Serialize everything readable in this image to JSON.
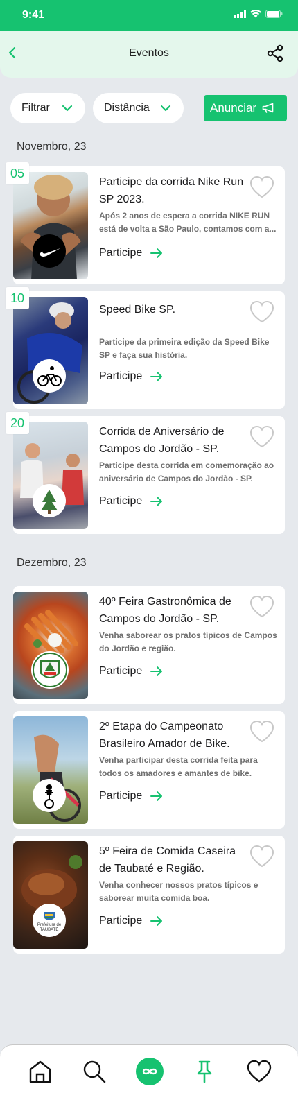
{
  "status": {
    "time": "9:41"
  },
  "header": {
    "title": "Eventos"
  },
  "filters": {
    "filtrar": "Filtrar",
    "distancia": "Distância",
    "anunciar": "Anunciar"
  },
  "sections": [
    {
      "month": "Novembro, 23",
      "events": [
        {
          "date": "05",
          "title": "Participe da corrida Nike Run SP 2023.",
          "description": "Após 2 anos de espera a corrida NIKE RUN está de volta a São Paulo, contamos com a...",
          "cta": "Participe"
        },
        {
          "date": "10",
          "title": "Speed Bike SP.",
          "description": "Participe da primeira edição da Speed Bike SP e faça sua história.",
          "cta": "Participe"
        },
        {
          "date": "20",
          "title": "Corrida de Aniversário de Campos do Jordão - SP.",
          "description": "Participe desta corrida em comemoração ao aniversário de Campos do Jordão - SP.",
          "cta": "Participe"
        }
      ]
    },
    {
      "month": "Dezembro, 23",
      "events": [
        {
          "title": "40º Feira Gastronômica de Campos do Jordão - SP.",
          "description": "Venha saborear os pratos típicos de Campos do Jordão e região.",
          "cta": "Participe"
        },
        {
          "title": "2º Etapa do Campeonato Brasileiro Amador de Bike.",
          "description": "Venha participar desta corrida feita para todos os amadores e amantes de bike.",
          "cta": "Participe"
        },
        {
          "title": "5º Feira de Comida Caseira de Taubaté e Região.",
          "description": "Venha conhecer nossos pratos típicos e saborear muita comida boa.",
          "cta": "Participe",
          "logo_text": "Prefeitura de TAUBATÉ"
        }
      ]
    }
  ],
  "tabbar": {
    "items": [
      "home-icon",
      "search-icon",
      "infinity-icon",
      "pin-icon",
      "heart-icon"
    ],
    "active": "infinity-icon"
  },
  "colors": {
    "accent": "#16c270",
    "header_bg": "#e4f7ec",
    "page_bg": "#e6e9ed"
  }
}
